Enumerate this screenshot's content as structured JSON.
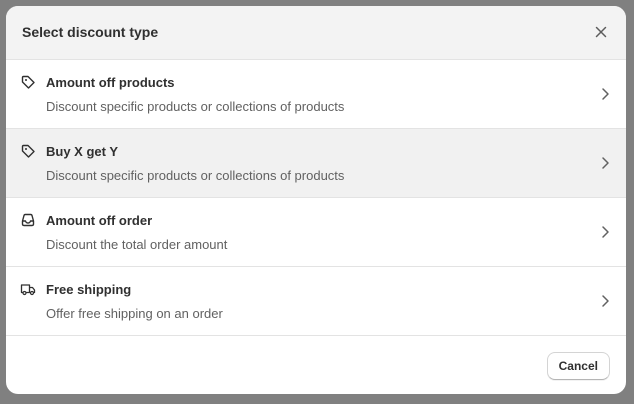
{
  "modal": {
    "title": "Select discount type",
    "close_icon": "close-icon",
    "options": [
      {
        "title": "Amount off products",
        "description": "Discount specific products or collections of products",
        "icon": "tag-icon"
      },
      {
        "title": "Buy X get Y",
        "description": "Discount specific products or collections of products",
        "icon": "tag-icon"
      },
      {
        "title": "Amount off order",
        "description": "Discount the total order amount",
        "icon": "cart-icon"
      },
      {
        "title": "Free shipping",
        "description": "Offer free shipping on an order",
        "icon": "truck-icon"
      }
    ],
    "footer": {
      "cancel_label": "Cancel"
    }
  },
  "colors": {
    "backdrop": "#808080",
    "header_bg": "#f3f3f3",
    "hover_row_bg": "#f1f1f1",
    "text_primary": "#303030",
    "text_secondary": "#616161",
    "divider": "#e3e3e3"
  }
}
